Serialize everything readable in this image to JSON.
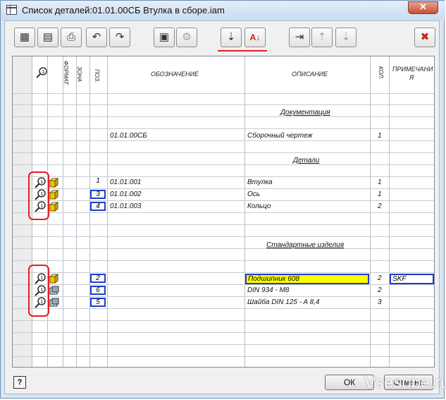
{
  "window": {
    "title": "Список деталей:01.01.00СБ Втулка в сборе.iam"
  },
  "toolbar": {
    "buttons": [
      {
        "name": "view-options-button",
        "icon": "table-view-icon",
        "glyph": "▦",
        "disabled": false
      },
      {
        "name": "column-chooser-button",
        "icon": "column-chooser-icon",
        "glyph": "▤",
        "disabled": false
      },
      {
        "name": "print-button",
        "icon": "print-icon",
        "glyph": "⎙",
        "disabled": false
      },
      {
        "name": "undo-button",
        "icon": "undo-icon",
        "glyph": "↶",
        "disabled": false
      },
      {
        "name": "redo-button",
        "icon": "redo-icon",
        "glyph": "↷",
        "disabled": false
      },
      {
        "name": "properties-button",
        "icon": "properties-icon",
        "glyph": "▣",
        "disabled": false
      },
      {
        "name": "structure-button",
        "icon": "structure-icon",
        "glyph": "⚙",
        "disabled": true
      },
      {
        "name": "renumber-button",
        "icon": "renumber-icon",
        "glyph": "⇣",
        "disabled": false
      },
      {
        "name": "sort-button",
        "icon": "sort-az-icon",
        "glyph": "A↓",
        "disabled": false
      },
      {
        "name": "insert-row-button",
        "icon": "insert-row-icon",
        "glyph": "⇥",
        "disabled": false
      },
      {
        "name": "move-up-button",
        "icon": "move-up-icon",
        "glyph": "⇡",
        "disabled": true
      },
      {
        "name": "move-down-button",
        "icon": "move-down-icon",
        "glyph": "⇣",
        "disabled": true
      },
      {
        "name": "export-button",
        "icon": "export-icon",
        "glyph": "✖",
        "disabled": false
      }
    ]
  },
  "table": {
    "headers": {
      "format": "ФОРМАТ",
      "zone": "ЗОНА",
      "pos": "ПОЗ.",
      "designation": "ОБОЗНАЧЕНИЕ",
      "description": "ОПИСАНИЕ",
      "qty": "КОЛ.",
      "notes_line1": "ПРИМЕЧАНИ",
      "notes_line2": "Я"
    },
    "sections": {
      "documentation": "Документация",
      "parts": "Детали",
      "standard": "Стандартные изделия"
    },
    "doc_row": {
      "designation": "01.01.00СБ",
      "description": "Сборочный чертеж",
      "qty": "1"
    },
    "parts": [
      {
        "pos": "1",
        "designation": "01.01.001",
        "description": "Втулка",
        "qty": "1"
      },
      {
        "pos": "3",
        "designation": "01.01.002",
        "description": "Ось",
        "qty": "1"
      },
      {
        "pos": "4",
        "designation": "01.01.003",
        "description": "Кольцо",
        "qty": "2"
      }
    ],
    "standard": [
      {
        "pos": "2",
        "designation": "",
        "description": "Подшипник 608",
        "qty": "2",
        "notes": "SKF"
      },
      {
        "pos": "6",
        "designation": "",
        "description": "DIN 934 - M8",
        "qty": "2",
        "notes": ""
      },
      {
        "pos": "5",
        "designation": "",
        "description": "Шайба DIN 125 - A 8,4",
        "qty": "3",
        "notes": ""
      }
    ]
  },
  "footer": {
    "help_label": "?",
    "ok_label": "ОК",
    "cancel_label": "Отмена"
  },
  "watermark": "Vsesobe.ru",
  "colors": {
    "highlight": "#ffff00",
    "selection_border": "#1f3cc7",
    "annotation_red": "#e21f26"
  }
}
